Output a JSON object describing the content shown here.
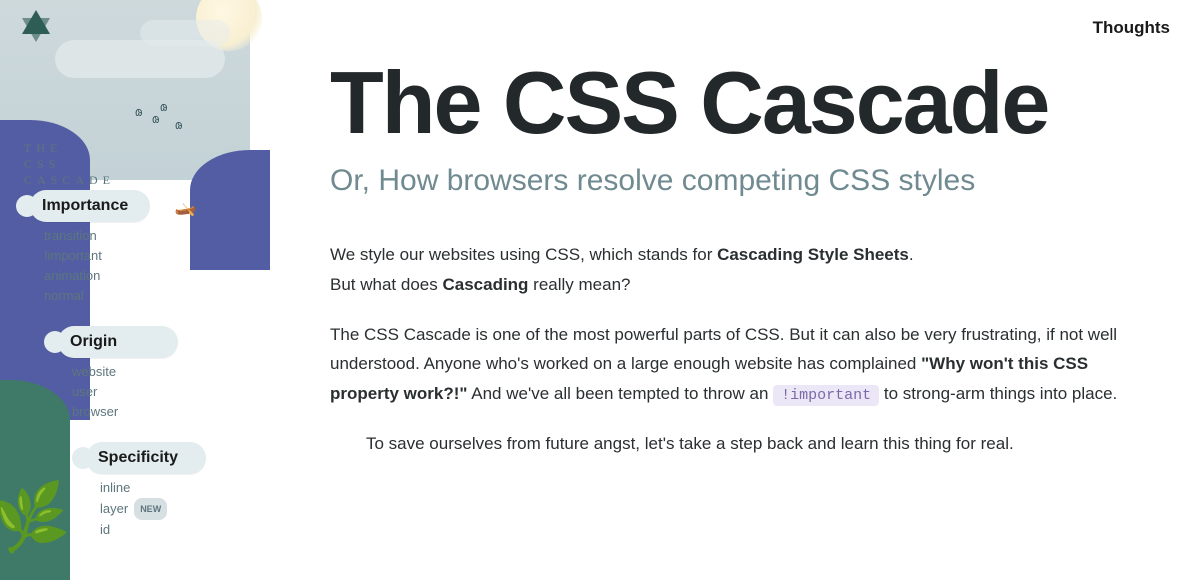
{
  "nav": {
    "thoughts": "Thoughts"
  },
  "sidebar": {
    "title_line1": "THE",
    "title_line2": "CSS",
    "title_line3": "CASCADE",
    "sections": [
      {
        "heading": "Importance",
        "items": [
          "transition",
          "!important",
          "animation",
          "normal"
        ]
      },
      {
        "heading": "Origin",
        "items": [
          "website",
          "user",
          "browser"
        ]
      },
      {
        "heading": "Specificity",
        "items": [
          "inline",
          "layer",
          "id"
        ],
        "badge_index": 1,
        "badge": "NEW"
      }
    ]
  },
  "article": {
    "title": "The CSS Cascade",
    "subtitle": "Or, How browsers resolve competing CSS styles",
    "p1_a": "We style our websites using CSS, which stands for ",
    "p1_b": "Cascading Style Sheets",
    "p1_c": ".",
    "p1_d": "But what does ",
    "p1_e": "Cascading",
    "p1_f": " really mean?",
    "p2_a": "The CSS Cascade is one of the most powerful parts of CSS. But it can also be very frustrating, if not well understood. Anyone who's worked on a large enough website has complained ",
    "p2_b": "\"Why won't this CSS property work?!\"",
    "p2_c": " And we've all been tempted to throw an ",
    "p2_code": "!important",
    "p2_d": " to strong-arm things into place.",
    "p3": "To save ourselves from future angst, let's take a step back and learn this thing for real."
  }
}
